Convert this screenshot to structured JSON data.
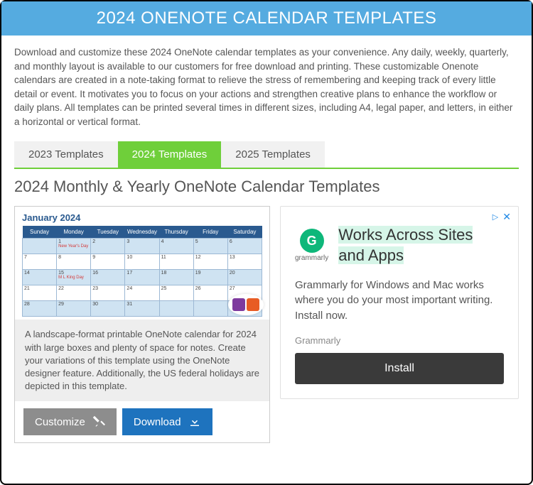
{
  "header": {
    "title": "2024 ONENOTE CALENDAR TEMPLATES"
  },
  "intro": "Download and customize these 2024 OneNote calendar templates as your convenience. Any daily, weekly, quarterly, and monthly layout is available to our customers for free download and printing. These customizable Onenote calendars are created in a note-taking format to relieve the stress of remembering and keeping track of every little detail or event. It motivates you to focus on your actions and strengthen creative plans to enhance the workflow or daily plans. All templates can be printed several times in different sizes, including A4, legal paper, and letters, in either a horizontal or vertical format.",
  "tabs": [
    {
      "label": "2023 Templates",
      "active": false
    },
    {
      "label": "2024 Templates",
      "active": true
    },
    {
      "label": "2025 Templates",
      "active": false
    }
  ],
  "section_title": "2024 Monthly & Yearly OneNote Calendar Templates",
  "card": {
    "thumb_title": "January 2024",
    "days": [
      "Sunday",
      "Monday",
      "Tuesday",
      "Wednesday",
      "Thursday",
      "Friday",
      "Saturday"
    ],
    "holidays": {
      "1": "New Year's Day",
      "15": "M L King Day"
    },
    "description": "A landscape-format printable OneNote calendar for 2024 with large boxes and plenty of space for notes. Create your variations of this template using the OneNote designer feature. Additionally, the US federal holidays are depicted in this template.",
    "customize_label": "Customize",
    "download_label": "Download"
  },
  "ad": {
    "info_icon": "▷",
    "close_icon": "✕",
    "logo_letter": "G",
    "logo_label": "grammarly",
    "headline_1": "Works Across Sites",
    "headline_2": "and Apps",
    "body": "Grammarly for Windows and Mac works where you do your most important writing. Install now.",
    "brand": "Grammarly",
    "cta": "Install"
  }
}
